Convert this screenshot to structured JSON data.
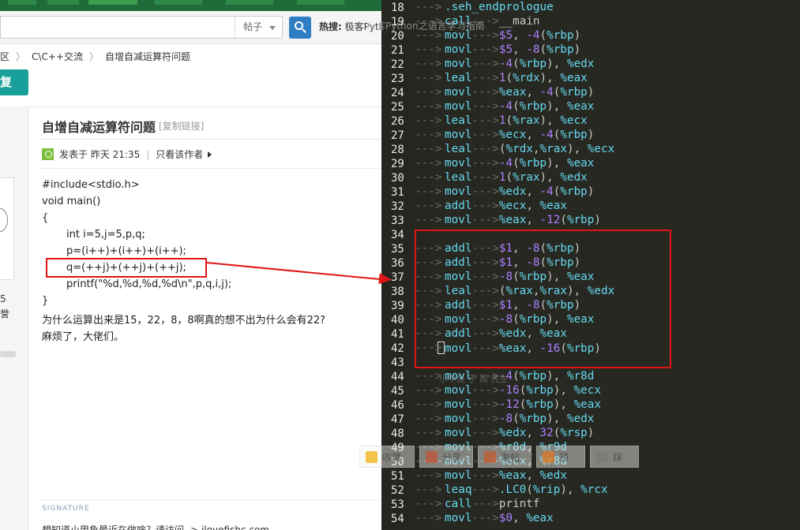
{
  "search": {
    "placeholder": "",
    "type_label": "帖子",
    "hot_label": "热搜:",
    "hot_text": "极客Python之语言学习指南"
  },
  "breadcrumb": {
    "item1": "区",
    "item2": "C\\C++交流",
    "item3": "自增自减运算符问题"
  },
  "reply_label": "复",
  "user": {
    "stat_num": "5",
    "stat_label": "誉"
  },
  "post": {
    "title": "自增自减运算符问题",
    "copy_link": "[复制链接]",
    "posted": "发表于 昨天 21:35",
    "only_author": "只看该作者",
    "code": [
      "#include<stdio.h>",
      "void main()",
      "{",
      "int i=5,j=5,p,q;",
      "p=(i++)+(i++)+(i++);",
      "q=(++j)+(++j)+(++j);",
      "printf(\"%d,%d,%d,%d\\n\",p,q,i,j);",
      "}",
      "为什么运算出来是15，22，8，8啊真的想不出为什么会有22?",
      "麻烦了，大佬们。"
    ],
    "signature_label": "SIGNATURE",
    "signature_text": "想知道小甲鱼最近在做啥？请访问 -> ilovefishc.com"
  },
  "float_bar": {
    "fav": "收藏",
    "share": "分享",
    "collect": "淘帖",
    "up": "顶",
    "down": "踩"
  },
  "editor": {
    "lines": [
      {
        "n": "18",
        "op": ".seh_endprologue",
        "args": ""
      },
      {
        "n": "19",
        "op": "call",
        "args": "__main"
      },
      {
        "n": "20",
        "op": "movl",
        "args": "$5, -4(%rbp)"
      },
      {
        "n": "21",
        "op": "movl",
        "args": "$5, -8(%rbp)"
      },
      {
        "n": "22",
        "op": "movl",
        "args": "-4(%rbp), %edx"
      },
      {
        "n": "23",
        "op": "leal",
        "args": "1(%rdx), %eax"
      },
      {
        "n": "24",
        "op": "movl",
        "args": "%eax, -4(%rbp)"
      },
      {
        "n": "25",
        "op": "movl",
        "args": "-4(%rbp), %eax"
      },
      {
        "n": "26",
        "op": "leal",
        "args": "1(%rax), %ecx"
      },
      {
        "n": "27",
        "op": "movl",
        "args": "%ecx, -4(%rbp)"
      },
      {
        "n": "28",
        "op": "leal",
        "args": "(%rdx,%rax), %ecx"
      },
      {
        "n": "29",
        "op": "movl",
        "args": "-4(%rbp), %eax"
      },
      {
        "n": "30",
        "op": "leal",
        "args": "1(%rax), %edx"
      },
      {
        "n": "31",
        "op": "movl",
        "args": "%edx, -4(%rbp)"
      },
      {
        "n": "32",
        "op": "addl",
        "args": "%ecx, %eax"
      },
      {
        "n": "33",
        "op": "movl",
        "args": "%eax, -12(%rbp)"
      },
      {
        "n": "34",
        "op": "",
        "args": ""
      },
      {
        "n": "35",
        "op": "addl",
        "args": "$1, -8(%rbp)"
      },
      {
        "n": "36",
        "op": "addl",
        "args": "$1, -8(%rbp)"
      },
      {
        "n": "37",
        "op": "movl",
        "args": "-8(%rbp), %eax"
      },
      {
        "n": "38",
        "op": "leal",
        "args": "(%rax,%rax), %edx"
      },
      {
        "n": "39",
        "op": "addl",
        "args": "$1, -8(%rbp)"
      },
      {
        "n": "40",
        "op": "movl",
        "args": "-8(%rbp), %eax"
      },
      {
        "n": "41",
        "op": "addl",
        "args": "%edx, %eax"
      },
      {
        "n": "42",
        "op": "movl",
        "args": "%eax, -16(%rbp)"
      },
      {
        "n": "43",
        "op": "",
        "args": ""
      },
      {
        "n": "44",
        "op": "movl",
        "args": "-4(%rbp), %r8d"
      },
      {
        "n": "45",
        "op": "movl",
        "args": "-16(%rbp), %ecx"
      },
      {
        "n": "46",
        "op": "movl",
        "args": "-12(%rbp), %eax"
      },
      {
        "n": "47",
        "op": "movl",
        "args": "-8(%rbp), %edx"
      },
      {
        "n": "48",
        "op": "movl",
        "args": "%edx, 32(%rsp)"
      },
      {
        "n": "49",
        "op": "movl",
        "args": "%r8d, %r9d"
      },
      {
        "n": "50",
        "op": "movl",
        "args": "%ecx, %r8d"
      },
      {
        "n": "51",
        "op": "movl",
        "args": "%eax, %edx"
      },
      {
        "n": "52",
        "op": "leaq",
        "args": ".LC0(%rip), %rcx"
      },
      {
        "n": "53",
        "op": "call",
        "args": "printf"
      },
      {
        "n": "54",
        "op": "movl",
        "args": "$0, %eax"
      }
    ],
    "watermark": "小甲鱼 于 周 先生"
  },
  "colors": {
    "editor_bg": "#272822",
    "keyword": "#66d9ef",
    "number": "#ae81ff",
    "highlight": "#e01515",
    "reply_button": "#1aa09a"
  }
}
